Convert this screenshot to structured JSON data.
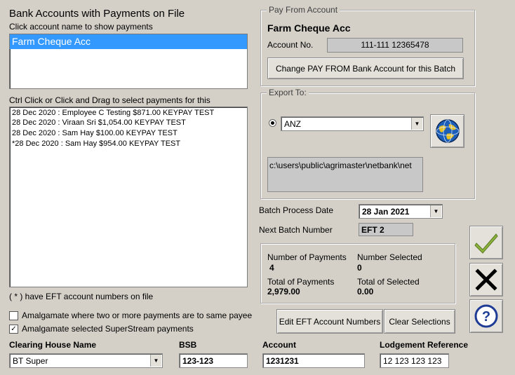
{
  "left": {
    "title": "Bank Accounts with Payments on File",
    "subtitle": "Click account name to show payments",
    "accounts": [
      "Farm Cheque Acc"
    ],
    "payments_label": "Ctrl Click or Click and Drag to select payments for this",
    "payments": [
      "28 Dec 2020 : Employee C Testing $871.00 KEYPAY TEST",
      "28 Dec 2020 : Viraan Sri $1,054.00 KEYPAY TEST",
      "28 Dec 2020 : Sam Hay $100.00 KEYPAY TEST",
      "*28 Dec 2020 : Sam Hay $954.00 KEYPAY TEST"
    ],
    "eft_note": "( * )  have EFT account numbers on file",
    "amalgamate_same_payee": {
      "label": "Amalgamate where two or more payments are to same payee",
      "checked": false
    },
    "amalgamate_superstream": {
      "label": "Amalgamate selected SuperStream payments",
      "checked": true
    }
  },
  "pay_from": {
    "legend": "Pay From Account",
    "account_name": "Farm Cheque Acc",
    "account_no_label": "Account No.",
    "account_no": "111-111 12365478",
    "change_button": "Change PAY FROM Bank Account for this Batch"
  },
  "export_to": {
    "legend": "Export To:",
    "bank": "ANZ",
    "path": "c:\\users\\public\\agrimaster\\netbank\\net"
  },
  "batch": {
    "date_label": "Batch Process Date",
    "date": "28  Jan  2021",
    "number_label": "Next Batch Number",
    "number": "EFT 2"
  },
  "summary": {
    "num_payments_label": "Number of Payments",
    "num_payments": "4",
    "num_selected_label": "Number Selected",
    "num_selected": "0",
    "total_payments_label": "Total of Payments",
    "total_payments": "2,979.00",
    "total_selected_label": "Total of Selected",
    "total_selected": "0.00"
  },
  "buttons": {
    "edit_eft": "Edit EFT Account Numbers",
    "clear_selections": "Clear Selections"
  },
  "bottom": {
    "clearing_house_label": "Clearing House Name",
    "clearing_house": "BT Super",
    "bsb_label": "BSB",
    "bsb": "123-123",
    "account_label": "Account",
    "account": "1231231",
    "lodgement_label": "Lodgement Reference",
    "lodgement": "12 123 123 123"
  },
  "icons": {
    "ok": "checkmark-icon",
    "cancel": "x-icon",
    "help": "question-icon",
    "globe": "globe-icon"
  },
  "colors": {
    "selection": "#3399ff",
    "check_green": "#8cb43c",
    "help_blue": "#1e3c96"
  }
}
